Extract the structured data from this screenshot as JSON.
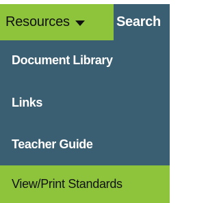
{
  "nav": {
    "resources_label": "Resources",
    "search_label": "Search"
  },
  "dropdown": {
    "items": [
      {
        "label": "Document Library"
      },
      {
        "label": "Links"
      },
      {
        "label": "Teacher Guide"
      },
      {
        "label": "View/Print Standards"
      }
    ]
  },
  "colors": {
    "menu_background": "#3a5f72",
    "accent_green": "#8dc43b",
    "text_light": "#ffffff",
    "text_dark": "#111111"
  },
  "icons": {
    "resources_dropdown": "caret-down-icon"
  }
}
